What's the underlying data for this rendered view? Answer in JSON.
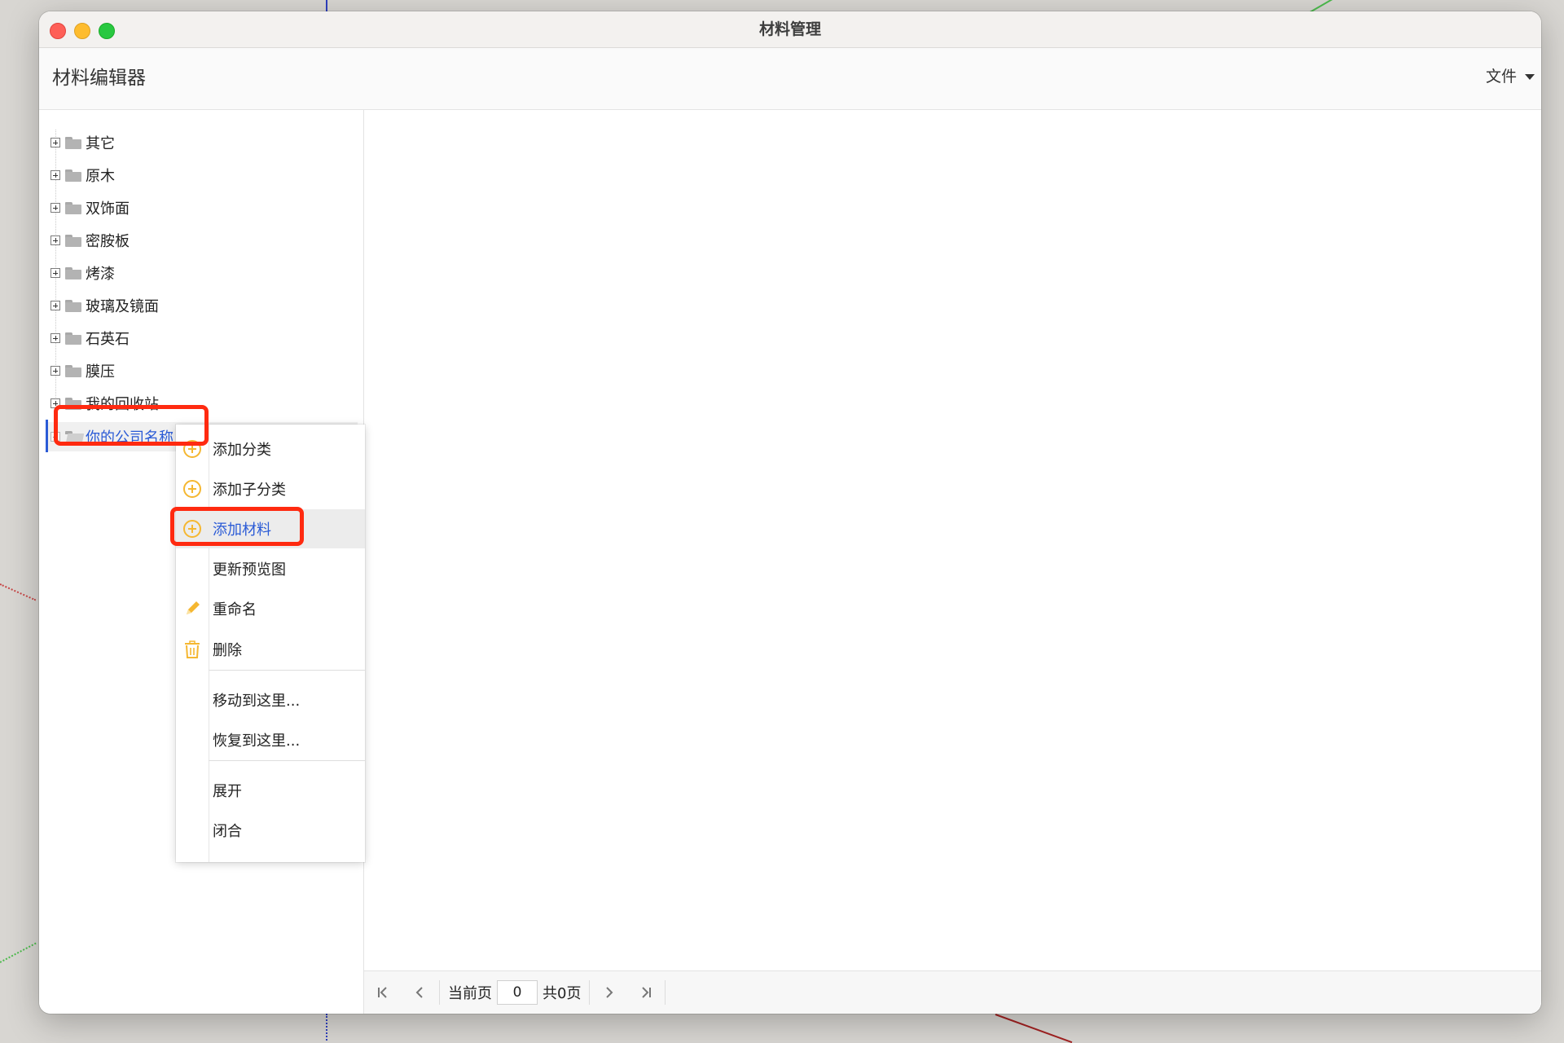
{
  "window": {
    "title": "材料管理"
  },
  "header": {
    "app_title": "材料编辑器",
    "file_menu_label": "文件"
  },
  "tree": {
    "items": [
      {
        "label": "其它"
      },
      {
        "label": "原木"
      },
      {
        "label": "双饰面"
      },
      {
        "label": "密胺板"
      },
      {
        "label": "烤漆"
      },
      {
        "label": "玻璃及镜面"
      },
      {
        "label": "石英石"
      },
      {
        "label": "膜压"
      },
      {
        "label": "我的回收站"
      },
      {
        "label": "你的公司名称"
      }
    ],
    "selected_index": 9
  },
  "context_menu": {
    "items": [
      {
        "label": "添加分类",
        "icon": "plus-circle-icon"
      },
      {
        "label": "添加子分类",
        "icon": "plus-circle-icon"
      },
      {
        "label": "添加材料",
        "icon": "plus-circle-icon"
      },
      {
        "label": "更新预览图",
        "icon": ""
      },
      {
        "label": "重命名",
        "icon": "pencil-icon"
      },
      {
        "label": "删除",
        "icon": "trash-icon"
      },
      {
        "label": "移动到这里...",
        "icon": ""
      },
      {
        "label": "恢复到这里...",
        "icon": ""
      },
      {
        "label": "展开",
        "icon": ""
      },
      {
        "label": "闭合",
        "icon": ""
      }
    ]
  },
  "pager": {
    "current_label": "当前页",
    "current_value": "0",
    "total_label": "共0页"
  },
  "colors": {
    "accent": "#2b5bd6",
    "highlight": "#ff2a10",
    "icon_yellow": "#f5b731"
  }
}
